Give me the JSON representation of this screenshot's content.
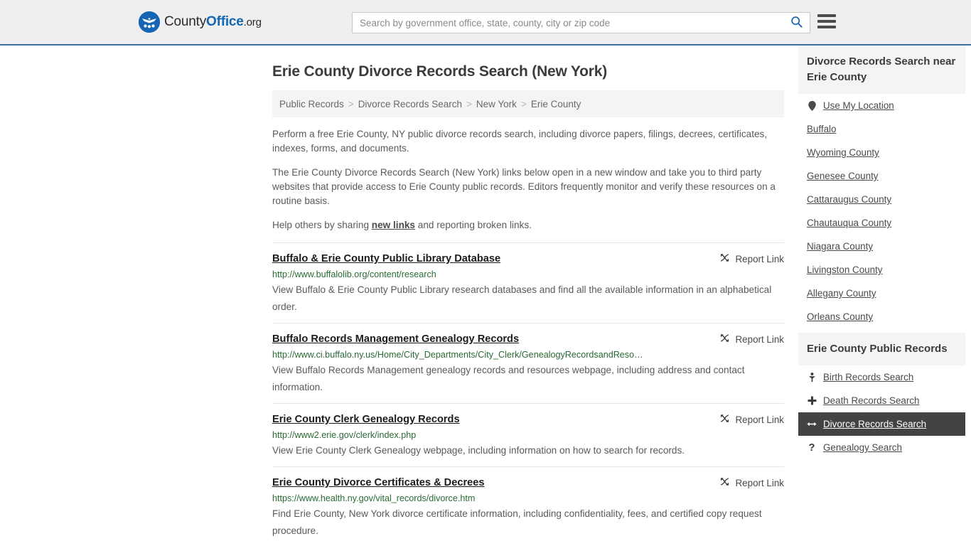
{
  "header": {
    "logo": {
      "part1": "County",
      "part2": "Office",
      "part3": ".org",
      "icon": "eagle-shield-logo-icon"
    },
    "search": {
      "placeholder": "Search by government office, state, county, city or zip code",
      "value": "",
      "search_icon": "search-icon"
    },
    "menu_icon": "hamburger-menu-icon",
    "accent_color": "#1565b5",
    "border_color": "#3d6f9e"
  },
  "page_title": "Erie County Divorce Records Search (New York)",
  "breadcrumb": {
    "separator": ">",
    "items": [
      "Public Records",
      "Divorce Records Search",
      "New York",
      "Erie County"
    ]
  },
  "intro": {
    "paragraph1": "Perform a free Erie County, NY public divorce records search, including divorce papers, filings, decrees, certificates, indexes, forms, and documents.",
    "paragraph2": "The Erie County Divorce Records Search (New York) links below open in a new window and take you to third party websites that provide access to Erie County public records. Editors frequently monitor and verify these resources on a routine basis.",
    "help_prefix": "Help others by sharing ",
    "help_link": "new links",
    "help_suffix": " and reporting broken links."
  },
  "results": {
    "report_label": "Report Link",
    "report_icon": "broken-link-icon",
    "items": [
      {
        "title": "Buffalo & Erie County Public Library Database",
        "url": "http://www.buffalolib.org/content/research",
        "description": "View Buffalo & Erie County Public Library research databases and find all the available information in an alphabetical order."
      },
      {
        "title": "Buffalo Records Management Genealogy Records",
        "url": "http://www.ci.buffalo.ny.us/Home/City_Departments/City_Clerk/GenealogyRecordsandReso…",
        "description": "View Buffalo Records Management genealogy records and resources webpage, including address and contact information."
      },
      {
        "title": "Erie County Clerk Genealogy Records",
        "url": "http://www2.erie.gov/clerk/index.php",
        "description": "View Erie County Clerk Genealogy webpage, including information on how to search for records."
      },
      {
        "title": "Erie County Divorce Certificates & Decrees",
        "url": "https://www.health.ny.gov/vital_records/divorce.htm",
        "description": "Find Erie County, New York divorce certificate information, including confidentiality, fees, and certified copy request procedure."
      }
    ]
  },
  "sidebar": {
    "nearby": {
      "heading": "Divorce Records Search near Erie County",
      "use_my_location": {
        "label": "Use My Location",
        "icon": "map-pin-icon"
      },
      "places": [
        "Buffalo",
        "Wyoming County",
        "Genesee County",
        "Cattaraugus County",
        "Chautauqua County",
        "Niagara County",
        "Livingston County",
        "Allegany County",
        "Orleans County"
      ]
    },
    "public_records": {
      "heading": "Erie County Public Records",
      "active_bg": "#434343",
      "items": [
        {
          "label": "Birth Records Search",
          "icon": "baby-icon",
          "glyph": "♁",
          "active": false
        },
        {
          "label": "Death Records Search",
          "icon": "cross-icon",
          "glyph": "✚",
          "active": false
        },
        {
          "label": "Divorce Records Search",
          "icon": "left-right-arrow-icon",
          "glyph": "↔",
          "active": true
        },
        {
          "label": "Genealogy Search",
          "icon": "question-mark-icon",
          "glyph": "?",
          "active": false
        }
      ]
    }
  }
}
